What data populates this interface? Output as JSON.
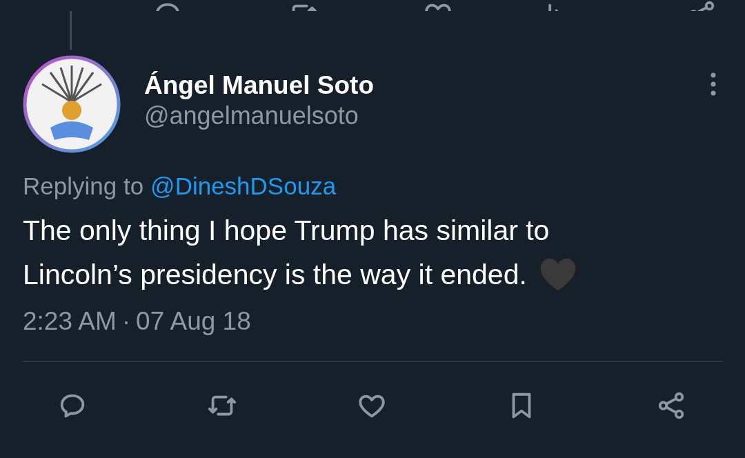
{
  "author": {
    "name": "Ángel Manuel Soto",
    "handle": "@angelmanuelsoto"
  },
  "reply_to": {
    "label": "Replying to",
    "handle": "@DineshDSouza"
  },
  "tweet": {
    "lines": [
      "The only thing I hope Trump has similar to",
      "Lincoln’s presidency is the way it ended."
    ]
  },
  "timestamp": {
    "time": "2:23 AM",
    "separator": "·",
    "date": "07 Aug 18"
  }
}
